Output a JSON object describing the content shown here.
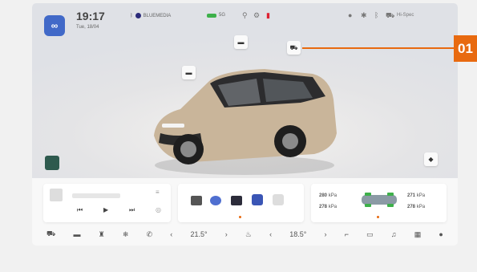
{
  "status": {
    "time": "19:17",
    "date": "Tue, 18/04",
    "media_label": "BLUEMEDIA",
    "signal_label": "5G",
    "right_label": "Hi-Spec"
  },
  "hero": {
    "side_label": "Seat mode"
  },
  "media": {
    "prev_icon": "⏮",
    "play_icon": "▶",
    "next_icon": "⏭"
  },
  "tire_card": {
    "front_left": "280",
    "rear_left": "278",
    "front_right": "271",
    "rear_right": "278",
    "unit": "kPa"
  },
  "climate": {
    "left_temp": "21.5°",
    "right_temp": "18.5°"
  },
  "callout": {
    "label": "01"
  },
  "colors": {
    "accent": "#e86a10",
    "brand": "#4169c8",
    "car_body": "#c9b59a"
  }
}
